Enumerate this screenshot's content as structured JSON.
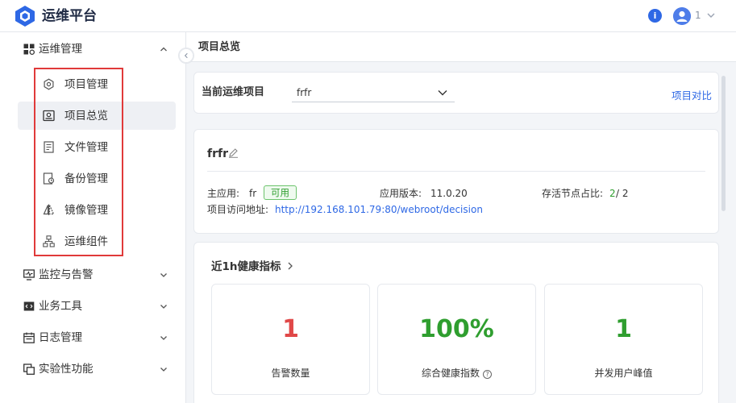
{
  "app": {
    "title": "运维平台",
    "user": "1"
  },
  "sidebar": {
    "groups": [
      {
        "label": "运维管理",
        "icon": "grid-icon",
        "expanded": true
      },
      {
        "label": "监控与告警",
        "icon": "monitor-icon"
      },
      {
        "label": "业务工具",
        "icon": "code-box-icon"
      },
      {
        "label": "日志管理",
        "icon": "calendar-icon"
      },
      {
        "label": "实验性功能",
        "icon": "flask-window-icon"
      }
    ],
    "items": [
      {
        "label": "项目管理",
        "icon": "gear-icon"
      },
      {
        "label": "项目总览",
        "icon": "overview-icon",
        "active": true
      },
      {
        "label": "文件管理",
        "icon": "file-icon"
      },
      {
        "label": "备份管理",
        "icon": "backup-icon"
      },
      {
        "label": "镜像管理",
        "icon": "image-icon"
      },
      {
        "label": "运维组件",
        "icon": "cluster-icon"
      }
    ]
  },
  "breadcrumb": "项目总览",
  "project_select": {
    "label": "当前运维项目",
    "value": "frfr",
    "compare_link": "项目对比"
  },
  "project": {
    "name": "frfr",
    "main_app_label": "主应用:",
    "main_app_value": "fr",
    "status_badge": "可用",
    "version_label": "应用版本:",
    "version_value": "11.0.20",
    "nodes_label": "存活节点占比:",
    "nodes_alive": "2",
    "nodes_total": "/ 2",
    "url_label": "项目访问地址:",
    "url_value": "http://192.168.101.79:80/webroot/decision"
  },
  "health": {
    "title": "近1h健康指标",
    "metrics": [
      {
        "value": "1",
        "label": "告警数量",
        "color": "#e04848"
      },
      {
        "value": "100%",
        "label": "综合健康指数",
        "color": "#2f9e2f"
      },
      {
        "value": "1",
        "label": "并发用户峰值",
        "color": "#2f9e2f"
      }
    ]
  },
  "colors": {
    "accent": "#2e68e5",
    "ok": "#2f9e2f",
    "alert": "#e04848",
    "highlight": "#e03a3a"
  }
}
